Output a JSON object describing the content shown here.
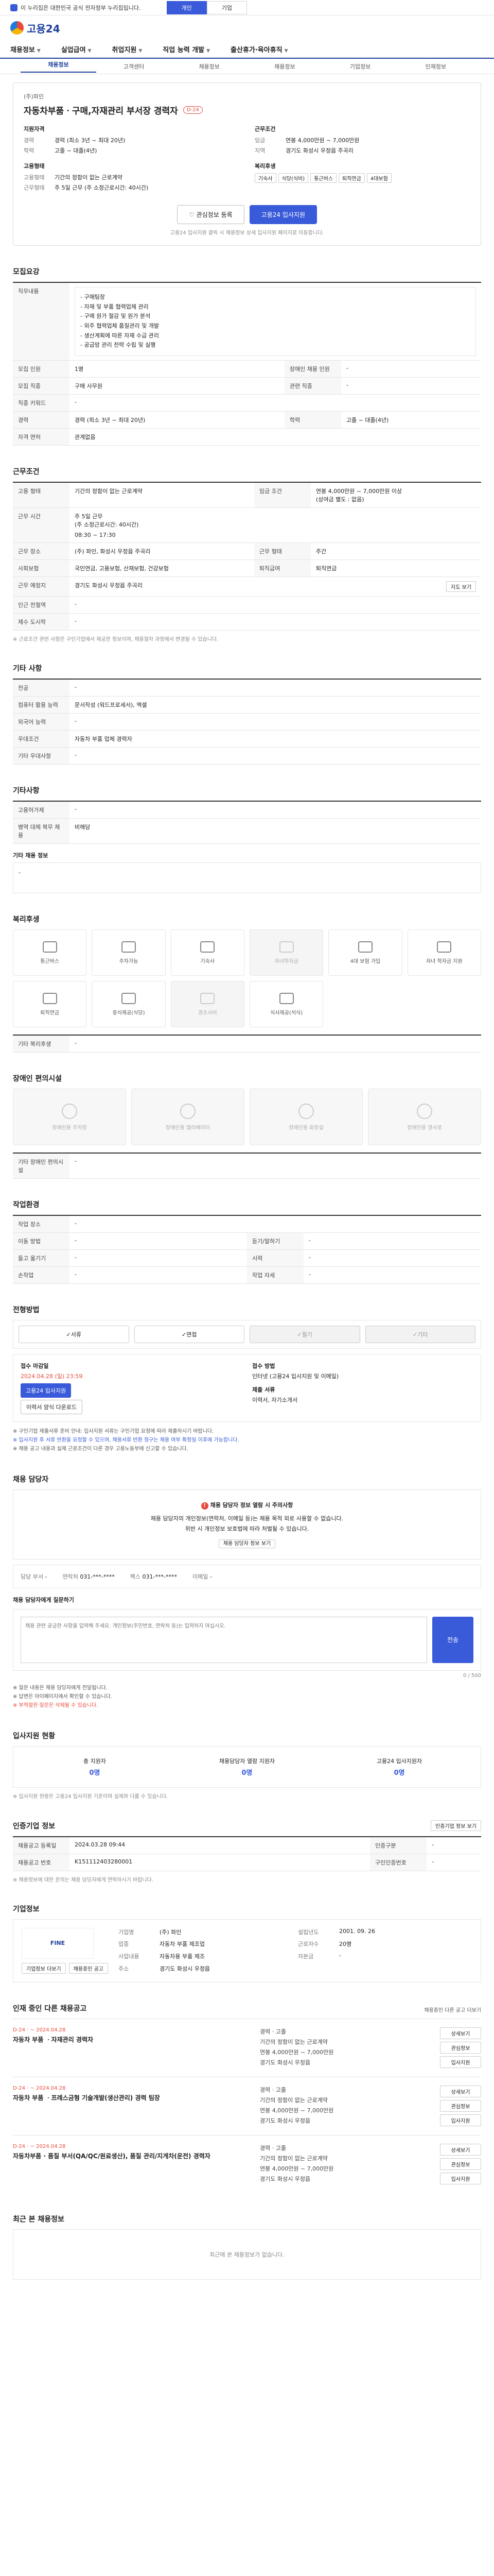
{
  "topbar": {
    "notice": "이 누리집은 대한민국 공식 전자정부 누리집입니다.",
    "tabs": [
      "개인",
      "기업"
    ]
  },
  "logo": {
    "text": "고용24"
  },
  "gnb": [
    "채용정보",
    "실업급여",
    "취업지원",
    "직업 능력 개발",
    "출산휴가·육아휴직"
  ],
  "subnav": [
    "채용정보",
    "고객센터",
    "채용정보",
    "채용정보",
    "기업정보",
    "인재정보"
  ],
  "summary": {
    "company": "(주)파인",
    "title": "자동차부품ㆍ구매,자재관리 부서장 경력자",
    "dday": "D-24",
    "qual_head": "지원자격",
    "qual": [
      {
        "k": "경력",
        "v": "경력 (최소 3년 ~ 최대 20년)"
      },
      {
        "k": "학력",
        "v": "고졸 ~ 대졸(4년)"
      }
    ],
    "cond_head": "근무조건",
    "cond": [
      {
        "k": "임금",
        "v": "연봉 4,000만원 ~ 7,000만원"
      },
      {
        "k": "지역",
        "v": "경기도 화성시 우정읍 주곡리"
      }
    ],
    "form_head": "고용형태",
    "form": [
      {
        "k": "고용형태",
        "v": "기간의 정함이 없는 근로계약"
      },
      {
        "k": "근무형태",
        "v": "주 5일 근무 (주 소정근로시간: 40시간)"
      }
    ],
    "welfare_head": "복리후생",
    "welfare": [
      "기숙사",
      "식당(식비)",
      "통근버스",
      "퇴직연금",
      "4대보험"
    ],
    "btn_scrap": "관심정보 등록",
    "btn_apply": "고용24 입사지원",
    "note": "고용24 입사지원 클릭 시 채용정보 상세 입사지원 페이지로 이동합니다."
  },
  "recruit": {
    "title": "모집요강",
    "duty_label": "직무내용",
    "duty_text": "- 구매팀장\n- 자재 및 부품 협력업체 관리\n- 구매 원가 절감 및 원가 분석\n- 외주 협력업체 품질관리 및 개발\n- 생산계획에 따른 자재 수급 관리\n- 공급망 관리 전략 수립 및 실행",
    "rows": [
      {
        "k": "모집 인원",
        "v": "1명",
        "k2": "장애인 채용 인원",
        "v2": "-"
      },
      {
        "k": "모집 직종",
        "v": "구매 사무원",
        "k2": "관련 직종",
        "v2": "-"
      },
      {
        "k": "직종 키워드",
        "v": "-",
        "k2": "",
        "v2": ""
      },
      {
        "k": "경력",
        "v": "경력 (최소 3년 ~ 최대 20년)",
        "k2": "학력",
        "v2": "고졸 ~ 대졸(4년)"
      },
      {
        "k": "자격 면허",
        "v": "관계없음",
        "k2": "",
        "v2": ""
      }
    ]
  },
  "work": {
    "title": "근무조건",
    "type": "기간의 정함이 없는 근로계약",
    "salary": "연봉 4,000만원 ~ 7,000만원 이상\n(상여금 별도 : 없음)",
    "hours": "주 5일 근무\n(주 소정근로시간: 40시간)",
    "hours_detail": "08:30 ~ 17:30",
    "site": "(주) 파인, 화성시 우정읍 주곡리",
    "insurance": "국민연금, 고용보험, 산재보험, 건강보험",
    "retire": "퇴직연금",
    "region": "경기도 화성시 우정읍 주곡리",
    "shift": "주간",
    "note": "※ 근로조건 관련 사항은 구인기업에서 제공한 정보이며, 채용절차 과정에서 변경될 수 있습니다."
  },
  "etc": {
    "title": "기타 사항",
    "rows": [
      {
        "k": "전공",
        "v": "-"
      },
      {
        "k": "컴퓨터 활용 능력",
        "v": "문서작성 (워드프로세서), 엑셀"
      },
      {
        "k": "외국어 능력",
        "v": "-"
      },
      {
        "k": "우대조건",
        "v": "자동차 부품 업체 경력자"
      },
      {
        "k": "기타 우대사항",
        "v": "-"
      }
    ]
  },
  "other": {
    "title": "기타사항",
    "rows": [
      {
        "k": "고용허가제",
        "v": "-"
      },
      {
        "k": "병역 대체 복무 채용",
        "v": "비해당"
      }
    ],
    "sub": "기타 채용 정보",
    "sub_v": "-"
  },
  "welfare": {
    "title": "복리후생",
    "items": [
      {
        "label": "통근버스",
        "dim": false
      },
      {
        "label": "주차가능",
        "dim": false
      },
      {
        "label": "기숙사",
        "dim": false
      },
      {
        "label": "자녀학자금",
        "dim": true
      },
      {
        "label": "4대 보험 가입",
        "dim": false
      },
      {
        "label": "자녀 학자금 지원",
        "dim": false
      },
      {
        "label": "퇴직연금",
        "dim": false
      },
      {
        "label": "중식제공(식당)",
        "dim": false
      },
      {
        "label": "경조사비",
        "dim": true
      },
      {
        "label": "식사제공(석식)",
        "dim": false
      }
    ],
    "etc_label": "기타 복리후생",
    "etc_v": "-"
  },
  "disability": {
    "title": "장애인 편의시설",
    "items": [
      "장애인용 주차장",
      "장애인용 엘리베이터",
      "장애인용 화장실",
      "장애인용 경사로"
    ],
    "etc_label": "기타 장애인 편의시설",
    "etc_v": "-"
  },
  "jobenv": {
    "title": "작업환경",
    "rows": [
      {
        "k": "작업 장소",
        "v": "-",
        "k2": "",
        "v2": ""
      },
      {
        "k": "이동 방법",
        "v": "-",
        "k2": "듣기/말하기",
        "v2": "-"
      },
      {
        "k": "들고 옮기기",
        "v": "-",
        "k2": "시력",
        "v2": "-"
      },
      {
        "k": "손작업",
        "v": "-",
        "k2": "작업 자세",
        "v2": "-"
      }
    ]
  },
  "apply": {
    "title": "전형방법",
    "methods": [
      {
        "label": "서류",
        "dim": false
      },
      {
        "label": "면접",
        "dim": false
      },
      {
        "label": "필기",
        "dim": true
      },
      {
        "label": "기타",
        "dim": true
      }
    ],
    "period_label": "접수 마감일",
    "period": "2024.04.28 (일) 23:59",
    "method_label": "접수 방법",
    "method_v": "인터넷 (고용24 입사지원 및 이메일)",
    "doc_label": "제출 서류",
    "doc_v": "이력서, 자기소개서",
    "btn_apply": "고용24 입사지원",
    "btn_form": "이력서 양식 다운로드",
    "bullets": [
      "※ 구인기업 제출서류 준비 안내: 입사지원 서류는 구인기업 요청에 따라 제출하시기 바랍니다.",
      "※ 입사지원 후 서류 반환을 요청할 수 있으며, 채용서류 반환 청구는 채용 여부 확정일 이후에 가능합니다.",
      "※ 채용 공고 내용과 실제 근로조건이 다른 경우 고용노동부에 신고할 수 있습니다."
    ]
  },
  "manager": {
    "title": "채용 담당자",
    "warn_title": "채용 담당자 정보 열람 시 주의사항",
    "warn_text": "채용 담당자의 개인정보(연락처, 이메일 등)는 채용 목적 외로 사용할 수 없습니다.\n위반 시 개인정보 보호법에 따라 처벌될 수 있습니다.",
    "btn": "채용 담당자 정보 보기",
    "company_label": "담당 부서",
    "company_v": "-",
    "phone_label": "연락처",
    "phone_v": "031-***-****",
    "fax_label": "팩스",
    "fax_v": "031-***-****",
    "email_label": "이메일",
    "email_v": "-",
    "question_title": "채용 담당자에게 질문하기",
    "question_ph": "채용 관련 궁금한 사항을 입력해 주세요. 개인정보(주민번호, 연락처 등)는 입력하지 마십시오.",
    "send": "전송",
    "counter": "0 / 500",
    "bullets": [
      "※ 질문 내용은 채용 담당자에게 전달됩니다.",
      "※ 답변은 마이페이지에서 확인할 수 있습니다.",
      "※ 부적절한 질문은 삭제될 수 있습니다."
    ]
  },
  "status": {
    "title": "입사지원 현황",
    "items": [
      {
        "label": "총 지원자",
        "num": "0명"
      },
      {
        "label": "채용담당자 열람 지원자",
        "num": "0명"
      },
      {
        "label": "고용24 입사지원자",
        "num": "0명"
      }
    ],
    "note": "※ 입사지원 현황은 고용24 입사지원 기준이며 실제와 다를 수 있습니다."
  },
  "recruit_info": {
    "title": "인증기업 정보",
    "btn": "인증기업 정보 보기",
    "rows": [
      {
        "k": "채용공고 등록일",
        "v": "2024.03.28 09:44",
        "k2": "인증구분",
        "v2": "-"
      },
      {
        "k": "채용공고 번호",
        "v": "K151112403280001",
        "k2": "구인인증번호",
        "v2": "-"
      }
    ],
    "note": "※ 채용정보에 대한 문의는 채용 담당자에게 연락하시기 바랍니다."
  },
  "corp": {
    "title": "기업정보",
    "logo": "FINE",
    "btn_info": "기업정보 더보기",
    "btn_jobs": "채용중인 공고",
    "rows": [
      {
        "k": "기업명",
        "v": "(주) 파인",
        "k2": "설립년도",
        "v2": "2001. 09. 26"
      },
      {
        "k": "업종",
        "v": "자동차 부품 제조업",
        "k2": "근로자수",
        "v2": "20명"
      },
      {
        "k": "사업내용",
        "v": "자동차용 부품 제조",
        "k2": "자본금",
        "v2": "-"
      },
      {
        "k": "주소",
        "v": "경기도 화성시 우정읍",
        "k2": "",
        "v2": ""
      }
    ]
  },
  "jobs": {
    "title": "인재 중인 다른 채용공고",
    "more": "채용중인 다른 공고 더보기",
    "items": [
      {
        "date": "D-24 · ~ 2024.04.28",
        "title": "자동차 부품 ㆍ자재관리 경력자",
        "m1": "경력",
        "m2": "고졸",
        "m3": "기간의 정함이 없는 근로계약",
        "m4": "연봉 4,000만원 ~ 7,000만원",
        "m5": "경기도 화성시 우정읍"
      },
      {
        "date": "D-24 · ~ 2024.04.28",
        "title": "자동차 부품 ㆍ프레스금형 기술개발(생산관리) 경력 팀장",
        "m1": "경력",
        "m2": "고졸",
        "m3": "기간의 정함이 없는 근로계약",
        "m4": "연봉 4,000만원 ~ 7,000만원",
        "m5": "경기도 화성시 우정읍"
      },
      {
        "date": "D-24 · ~ 2024.04.28",
        "title": "자동차부품 · 품질 부서(QA/QC/원료생산), 품질 관리/지게차(운전) 경력자",
        "m1": "경력",
        "m2": "고졸",
        "m3": "기간의 정함이 없는 근로계약",
        "m4": "연봉 4,000만원 ~ 7,000만원",
        "m5": "경기도 화성시 우정읍"
      }
    ],
    "acts": [
      "상세보기",
      "관심정보",
      "입사지원"
    ]
  },
  "recent": {
    "title": "최근 본 채용정보",
    "empty": "최근에 본 채용정보가 없습니다."
  },
  "colors": {
    "primary": "#3a5bd9",
    "accent": "#e84a3b",
    "brand": "#1d3f9e"
  }
}
